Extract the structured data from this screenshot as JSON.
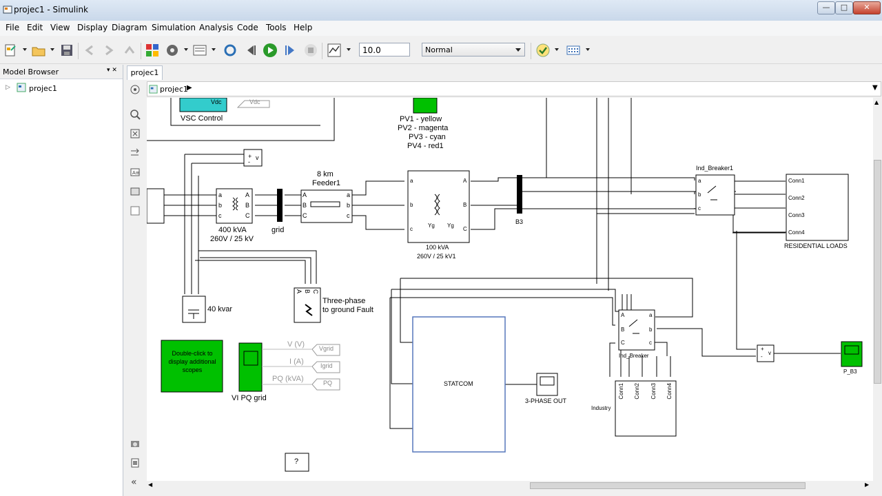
{
  "window": {
    "title": "projec1 - Simulink",
    "min": "—",
    "max": "□",
    "close": "✕"
  },
  "menu": [
    "File",
    "Edit",
    "View",
    "Display",
    "Diagram",
    "Simulation",
    "Analysis",
    "Code",
    "Tools",
    "Help"
  ],
  "toolbar": {
    "stop_time": "10.0",
    "sim_mode": "Normal"
  },
  "model_browser": {
    "title": "Model Browser",
    "tree_item": "projec1"
  },
  "tabs": {
    "active": "projec1"
  },
  "breadcrumb": "projec1",
  "diagram": {
    "vsc_control": "VSC Control",
    "vdc_port": "Vdc",
    "vdc_tag": "Vdc",
    "pv_legend": [
      "PV1 - yellow",
      "PV2 - magenta",
      "PV3 - cyan",
      "PV4 - red1"
    ],
    "feeder_title1": "8 km",
    "feeder_title2": "Feeder1",
    "tx1_label1": "400 kVA",
    "tx1_label2": "260V / 25 kV",
    "grid": "grid",
    "tx2_label1": "100 kVA",
    "tx2_label2": "260V / 25 kV1",
    "b3": "B3",
    "ind_breaker1": "Ind_Breaker1",
    "residential_loads": "RESIDENTIAL LOADS",
    "conn": [
      "Conn1",
      "Conn2",
      "Conn3",
      "Conn4"
    ],
    "cap": "40 kvar",
    "fault1": "Three-phase",
    "fault2": "to ground Fault",
    "double_click": "Double-click to display additional scopes",
    "vi_pq": "VI PQ grid",
    "v_label": "V (V)",
    "i_label": "I (A)",
    "pq_label": "PQ (kVA)",
    "vgrid": "Vgrid",
    "igrid": "Igrid",
    "pq": "PQ",
    "statcom": "STATCOM",
    "three_phase_out": "3-PHASE OUT",
    "ind_breaker": "Ind_Breaker",
    "industry": "Industry",
    "p_b3": "P_B3",
    "help": "?",
    "abc": [
      "A",
      "B",
      "C"
    ],
    "abc_lower": [
      "a",
      "b",
      "c"
    ],
    "yg": "Yg",
    "plus": "+",
    "minus": "-",
    "v": "v"
  },
  "colors": {
    "green_block": "#00c000",
    "cyan_block": "#33cccc",
    "canvas": "#ffffff"
  }
}
